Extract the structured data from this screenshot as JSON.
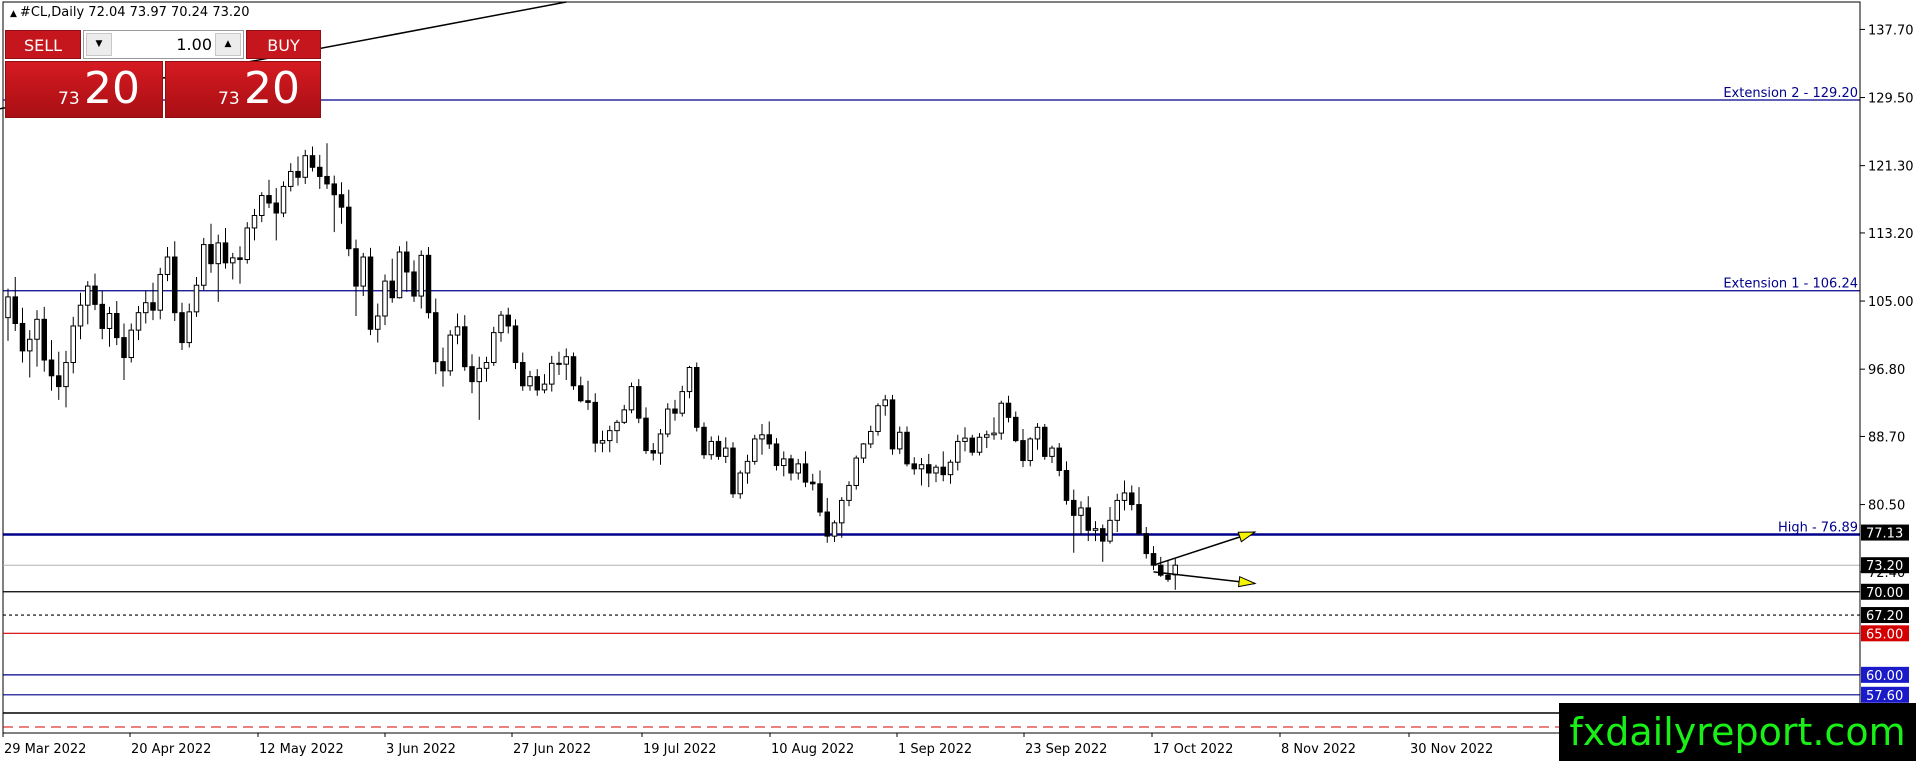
{
  "header": {
    "symbol_line": "#CL,Daily  72.04 73.97 70.24 73.20"
  },
  "trade_panel": {
    "sell_label": "SELL",
    "buy_label": "BUY",
    "lot_value": "1.00",
    "sell_price_small": "73",
    "sell_price_big": "20",
    "buy_price_small": "73",
    "buy_price_big": "20",
    "dec_icon": "triangle-down",
    "inc_icon": "triangle-up"
  },
  "watermark": "fxdailyreport.com",
  "colors": {
    "bull": "#ffffff",
    "bear": "#000000",
    "navy": "#00008b",
    "blue_tag": "#1a1ac8",
    "red": "#d40000",
    "watermark_bg": "#000000",
    "watermark_text": "#18f018"
  },
  "chart_data": {
    "type": "candlestick",
    "symbol": "#CL",
    "timeframe": "Daily",
    "ohlc_last": {
      "open": 72.04,
      "high": 73.97,
      "low": 70.24,
      "close": 73.2
    },
    "x_tick_labels": [
      "29 Mar 2022",
      "20 Apr 2022",
      "12 May 2022",
      "3 Jun 2022",
      "27 Jun 2022",
      "19 Jul 2022",
      "10 Aug 2022",
      "1 Sep 2022",
      "23 Sep 2022",
      "17 Oct 2022",
      "8 Nov 2022",
      "30 Nov 2022"
    ],
    "y_tick_labels": [
      137.7,
      129.5,
      121.3,
      113.2,
      105.0,
      96.8,
      88.7,
      80.5,
      72.4
    ],
    "ylim": [
      53.0,
      141.0
    ],
    "levels": [
      {
        "label": "Extension 2 - 129.20",
        "value": 129.2,
        "style": "solid",
        "color": "#00008b"
      },
      {
        "label": "Extension 1 - 106.24",
        "value": 106.24,
        "style": "solid",
        "color": "#00008b"
      },
      {
        "label": "High - 76.89",
        "value": 76.89,
        "style": "bold",
        "color": "#00008b"
      },
      {
        "value": 70.0,
        "style": "solid",
        "color": "#000000"
      },
      {
        "value": 67.2,
        "style": "dashed",
        "color": "#000000"
      },
      {
        "value": 65.0,
        "style": "solid",
        "color": "#d40000"
      },
      {
        "value": 60.0,
        "style": "solid",
        "color": "#00008b"
      },
      {
        "value": 57.6,
        "style": "solid",
        "color": "#00008b"
      }
    ],
    "price_tags": [
      {
        "text": "77.13",
        "value": 77.13,
        "bg": "#000000"
      },
      {
        "text": "73.20",
        "value": 73.2,
        "bg": "#000000"
      },
      {
        "text": "70.00",
        "value": 70.0,
        "bg": "#000000"
      },
      {
        "text": "67.20",
        "value": 67.2,
        "bg": "#000000"
      },
      {
        "text": "65.00",
        "value": 65.0,
        "bg": "#d40000"
      },
      {
        "text": "60.00",
        "value": 60.0,
        "bg": "#1a1ac8"
      },
      {
        "text": "57.60",
        "value": 57.6,
        "bg": "#1a1ac8"
      }
    ],
    "candles": [
      [
        103.0,
        106.5,
        100.2,
        105.5
      ],
      [
        105.5,
        107.9,
        101.4,
        102.3
      ],
      [
        102.3,
        104.2,
        97.6,
        99.0
      ],
      [
        99.0,
        101.5,
        95.8,
        100.4
      ],
      [
        100.4,
        103.9,
        97.1,
        102.8
      ],
      [
        102.8,
        104.3,
        96.5,
        97.9
      ],
      [
        97.9,
        100.3,
        94.2,
        96.0
      ],
      [
        96.0,
        98.9,
        93.1,
        94.7
      ],
      [
        94.7,
        99.0,
        92.2,
        97.6
      ],
      [
        97.6,
        103.1,
        96.3,
        102.0
      ],
      [
        102.0,
        106.0,
        100.4,
        104.5
      ],
      [
        104.5,
        107.4,
        102.2,
        106.8
      ],
      [
        106.8,
        108.3,
        103.9,
        104.6
      ],
      [
        104.6,
        106.2,
        100.4,
        101.7
      ],
      [
        101.7,
        104.3,
        99.5,
        103.5
      ],
      [
        103.5,
        105.0,
        99.7,
        100.6
      ],
      [
        100.6,
        102.3,
        95.5,
        98.2
      ],
      [
        98.2,
        102.3,
        97.6,
        101.5
      ],
      [
        101.5,
        104.4,
        100.3,
        103.6
      ],
      [
        103.6,
        106.2,
        102.3,
        104.8
      ],
      [
        104.8,
        107.2,
        102.7,
        103.9
      ],
      [
        103.9,
        109.0,
        102.8,
        108.2
      ],
      [
        108.2,
        111.5,
        107.4,
        110.3
      ],
      [
        110.3,
        112.2,
        102.6,
        103.6
      ],
      [
        103.6,
        104.8,
        99.1,
        100.0
      ],
      [
        100.0,
        104.7,
        99.4,
        103.7
      ],
      [
        103.7,
        107.9,
        103.1,
        106.9
      ],
      [
        106.9,
        112.6,
        106.3,
        111.8
      ],
      [
        111.8,
        114.3,
        108.4,
        109.5
      ],
      [
        109.5,
        113.0,
        104.9,
        112.0
      ],
      [
        112.0,
        113.8,
        108.9,
        109.6
      ],
      [
        109.6,
        110.8,
        107.6,
        110.2
      ],
      [
        110.2,
        111.6,
        107.1,
        110.0
      ],
      [
        110.0,
        114.5,
        109.5,
        113.8
      ],
      [
        113.8,
        116.1,
        112.3,
        115.3
      ],
      [
        115.3,
        118.1,
        114.5,
        117.7
      ],
      [
        117.7,
        119.6,
        116.2,
        116.8
      ],
      [
        116.8,
        118.6,
        112.3,
        115.6
      ],
      [
        115.6,
        119.4,
        115.1,
        118.8
      ],
      [
        118.8,
        121.6,
        118.2,
        120.6
      ],
      [
        120.6,
        122.4,
        118.9,
        119.9
      ],
      [
        119.9,
        123.2,
        119.1,
        122.5
      ],
      [
        122.5,
        123.6,
        120.6,
        121.1
      ],
      [
        121.1,
        122.6,
        118.5,
        120.0
      ],
      [
        120.0,
        124.0,
        118.5,
        119.1
      ],
      [
        119.1,
        120.1,
        113.3,
        117.8
      ],
      [
        117.8,
        119.3,
        114.3,
        116.3
      ],
      [
        116.3,
        118.4,
        110.4,
        111.3
      ],
      [
        111.3,
        112.4,
        103.2,
        106.8
      ],
      [
        106.8,
        110.8,
        105.6,
        110.3
      ],
      [
        110.3,
        111.4,
        100.9,
        101.6
      ],
      [
        101.6,
        104.7,
        100.0,
        103.2
      ],
      [
        103.2,
        108.2,
        102.1,
        107.4
      ],
      [
        107.4,
        110.1,
        104.8,
        105.4
      ],
      [
        105.4,
        111.6,
        105.3,
        110.9
      ],
      [
        110.9,
        112.2,
        106.1,
        108.5
      ],
      [
        108.5,
        109.9,
        104.9,
        105.6
      ],
      [
        105.6,
        111.1,
        104.1,
        110.5
      ],
      [
        110.5,
        111.5,
        102.9,
        103.6
      ],
      [
        103.6,
        105.3,
        96.2,
        97.7
      ],
      [
        97.7,
        99.4,
        94.7,
        96.6
      ],
      [
        96.6,
        101.5,
        96.0,
        100.9
      ],
      [
        100.9,
        103.5,
        99.8,
        101.9
      ],
      [
        101.9,
        103.3,
        96.6,
        97.1
      ],
      [
        97.1,
        98.6,
        93.9,
        95.3
      ],
      [
        95.3,
        98.3,
        90.7,
        96.9
      ],
      [
        96.9,
        98.3,
        95.3,
        97.6
      ],
      [
        97.6,
        101.9,
        97.2,
        101.2
      ],
      [
        101.2,
        103.8,
        100.1,
        103.3
      ],
      [
        103.3,
        104.2,
        101.1,
        102.0
      ],
      [
        102.0,
        102.8,
        96.8,
        97.6
      ],
      [
        97.6,
        98.8,
        94.2,
        94.8
      ],
      [
        94.8,
        96.6,
        94.2,
        95.9
      ],
      [
        95.9,
        96.8,
        93.6,
        94.3
      ],
      [
        94.3,
        96.2,
        93.9,
        95.0
      ],
      [
        95.0,
        98.4,
        94.1,
        97.5
      ],
      [
        97.5,
        98.9,
        96.1,
        97.4
      ],
      [
        97.4,
        99.3,
        95.5,
        98.3
      ],
      [
        98.3,
        98.8,
        94.3,
        94.8
      ],
      [
        94.8,
        95.9,
        92.8,
        93.0
      ],
      [
        93.0,
        95.4,
        91.9,
        92.8
      ],
      [
        92.8,
        93.9,
        86.8,
        87.9
      ],
      [
        87.9,
        89.4,
        86.8,
        88.2
      ],
      [
        88.2,
        90.0,
        86.8,
        89.4
      ],
      [
        89.4,
        90.7,
        87.9,
        90.4
      ],
      [
        90.4,
        92.5,
        90.2,
        91.9
      ],
      [
        91.9,
        95.2,
        91.5,
        94.7
      ],
      [
        94.7,
        95.6,
        90.3,
        90.9
      ],
      [
        90.9,
        92.2,
        86.6,
        87.0
      ],
      [
        87.0,
        87.9,
        85.8,
        86.7
      ],
      [
        86.7,
        89.6,
        85.3,
        89.0
      ],
      [
        89.0,
        92.7,
        88.6,
        92.0
      ],
      [
        92.0,
        93.1,
        90.6,
        91.5
      ],
      [
        91.5,
        94.8,
        91.1,
        94.1
      ],
      [
        94.1,
        97.2,
        93.3,
        97.0
      ],
      [
        97.0,
        97.6,
        89.3,
        89.8
      ],
      [
        89.8,
        90.4,
        86.0,
        86.5
      ],
      [
        86.5,
        88.7,
        85.9,
        88.1
      ],
      [
        88.1,
        88.8,
        85.9,
        86.3
      ],
      [
        86.3,
        88.6,
        85.5,
        87.3
      ],
      [
        87.3,
        88.0,
        81.3,
        81.8
      ],
      [
        81.8,
        84.6,
        81.2,
        84.3
      ],
      [
        84.3,
        86.5,
        83.0,
        85.7
      ],
      [
        85.7,
        88.9,
        85.3,
        88.4
      ],
      [
        88.4,
        90.2,
        86.5,
        88.9
      ],
      [
        88.9,
        90.5,
        87.2,
        87.8
      ],
      [
        87.8,
        88.5,
        84.6,
        85.2
      ],
      [
        85.2,
        86.9,
        83.9,
        86.0
      ],
      [
        86.0,
        86.5,
        83.4,
        84.3
      ],
      [
        84.3,
        86.0,
        83.5,
        85.4
      ],
      [
        85.4,
        86.9,
        82.6,
        83.2
      ],
      [
        83.2,
        84.2,
        82.2,
        83.0
      ],
      [
        83.0,
        84.6,
        79.1,
        79.6
      ],
      [
        79.6,
        81.3,
        75.9,
        76.7
      ],
      [
        76.7,
        78.6,
        76.0,
        78.3
      ],
      [
        78.3,
        81.4,
        76.5,
        81.0
      ],
      [
        81.0,
        83.3,
        80.3,
        82.8
      ],
      [
        82.8,
        86.4,
        82.3,
        86.1
      ],
      [
        86.1,
        87.9,
        85.5,
        87.8
      ],
      [
        87.8,
        90.0,
        87.3,
        89.3
      ],
      [
        89.3,
        92.7,
        88.8,
        92.4
      ],
      [
        92.4,
        93.7,
        91.2,
        93.1
      ],
      [
        93.1,
        93.7,
        86.5,
        87.2
      ],
      [
        87.2,
        89.9,
        86.6,
        89.2
      ],
      [
        89.2,
        89.9,
        85.1,
        85.4
      ],
      [
        85.4,
        86.2,
        84.1,
        84.8
      ],
      [
        84.8,
        86.1,
        82.8,
        85.3
      ],
      [
        85.3,
        86.6,
        82.6,
        84.3
      ],
      [
        84.3,
        85.3,
        83.2,
        85.0
      ],
      [
        85.0,
        86.9,
        83.3,
        84.1
      ],
      [
        84.1,
        85.9,
        83.0,
        85.6
      ],
      [
        85.6,
        88.9,
        84.6,
        88.1
      ],
      [
        88.1,
        89.8,
        86.9,
        88.5
      ],
      [
        88.5,
        88.9,
        86.4,
        86.8
      ],
      [
        86.8,
        89.1,
        86.4,
        88.6
      ],
      [
        88.6,
        89.4,
        87.3,
        88.9
      ],
      [
        88.9,
        91.0,
        88.3,
        89.1
      ],
      [
        89.1,
        93.0,
        88.3,
        92.7
      ],
      [
        92.7,
        93.6,
        90.4,
        91.0
      ],
      [
        91.0,
        91.7,
        88.0,
        88.2
      ],
      [
        88.2,
        89.6,
        85.0,
        85.8
      ],
      [
        85.8,
        88.6,
        85.1,
        88.4
      ],
      [
        88.4,
        90.3,
        87.1,
        89.8
      ],
      [
        89.8,
        90.2,
        85.9,
        86.3
      ],
      [
        86.3,
        87.6,
        85.5,
        87.3
      ],
      [
        87.3,
        87.9,
        83.9,
        84.6
      ],
      [
        84.6,
        85.7,
        80.5,
        81.0
      ],
      [
        81.0,
        82.3,
        74.7,
        79.2
      ],
      [
        79.2,
        80.9,
        76.8,
        80.1
      ],
      [
        80.1,
        81.5,
        76.1,
        77.4
      ],
      [
        77.4,
        78.5,
        76.1,
        77.6
      ],
      [
        77.6,
        78.1,
        73.6,
        76.1
      ],
      [
        76.1,
        80.2,
        75.8,
        78.6
      ],
      [
        78.6,
        81.8,
        77.2,
        81.0
      ],
      [
        81.0,
        83.4,
        79.8,
        81.9
      ],
      [
        81.9,
        82.8,
        79.8,
        80.5
      ],
      [
        80.5,
        82.6,
        76.8,
        77.0
      ],
      [
        77.0,
        77.8,
        74.0,
        74.6
      ],
      [
        74.6,
        75.5,
        72.6,
        73.2
      ],
      [
        73.2,
        74.2,
        71.8,
        72.0
      ],
      [
        72.0,
        73.8,
        71.2,
        71.5
      ],
      [
        72.04,
        73.97,
        70.24,
        73.2
      ]
    ],
    "trendline": [
      {
        "index": -2,
        "value": 128.0
      },
      {
        "index": 77,
        "value": 141.0
      }
    ],
    "arrows": [
      {
        "from_index": 158,
        "from_value": 73.2,
        "to_index": 172,
        "to_value": 77.2
      },
      {
        "from_index": 158,
        "from_value": 72.4,
        "to_index": 172,
        "to_value": 71.0
      }
    ]
  }
}
